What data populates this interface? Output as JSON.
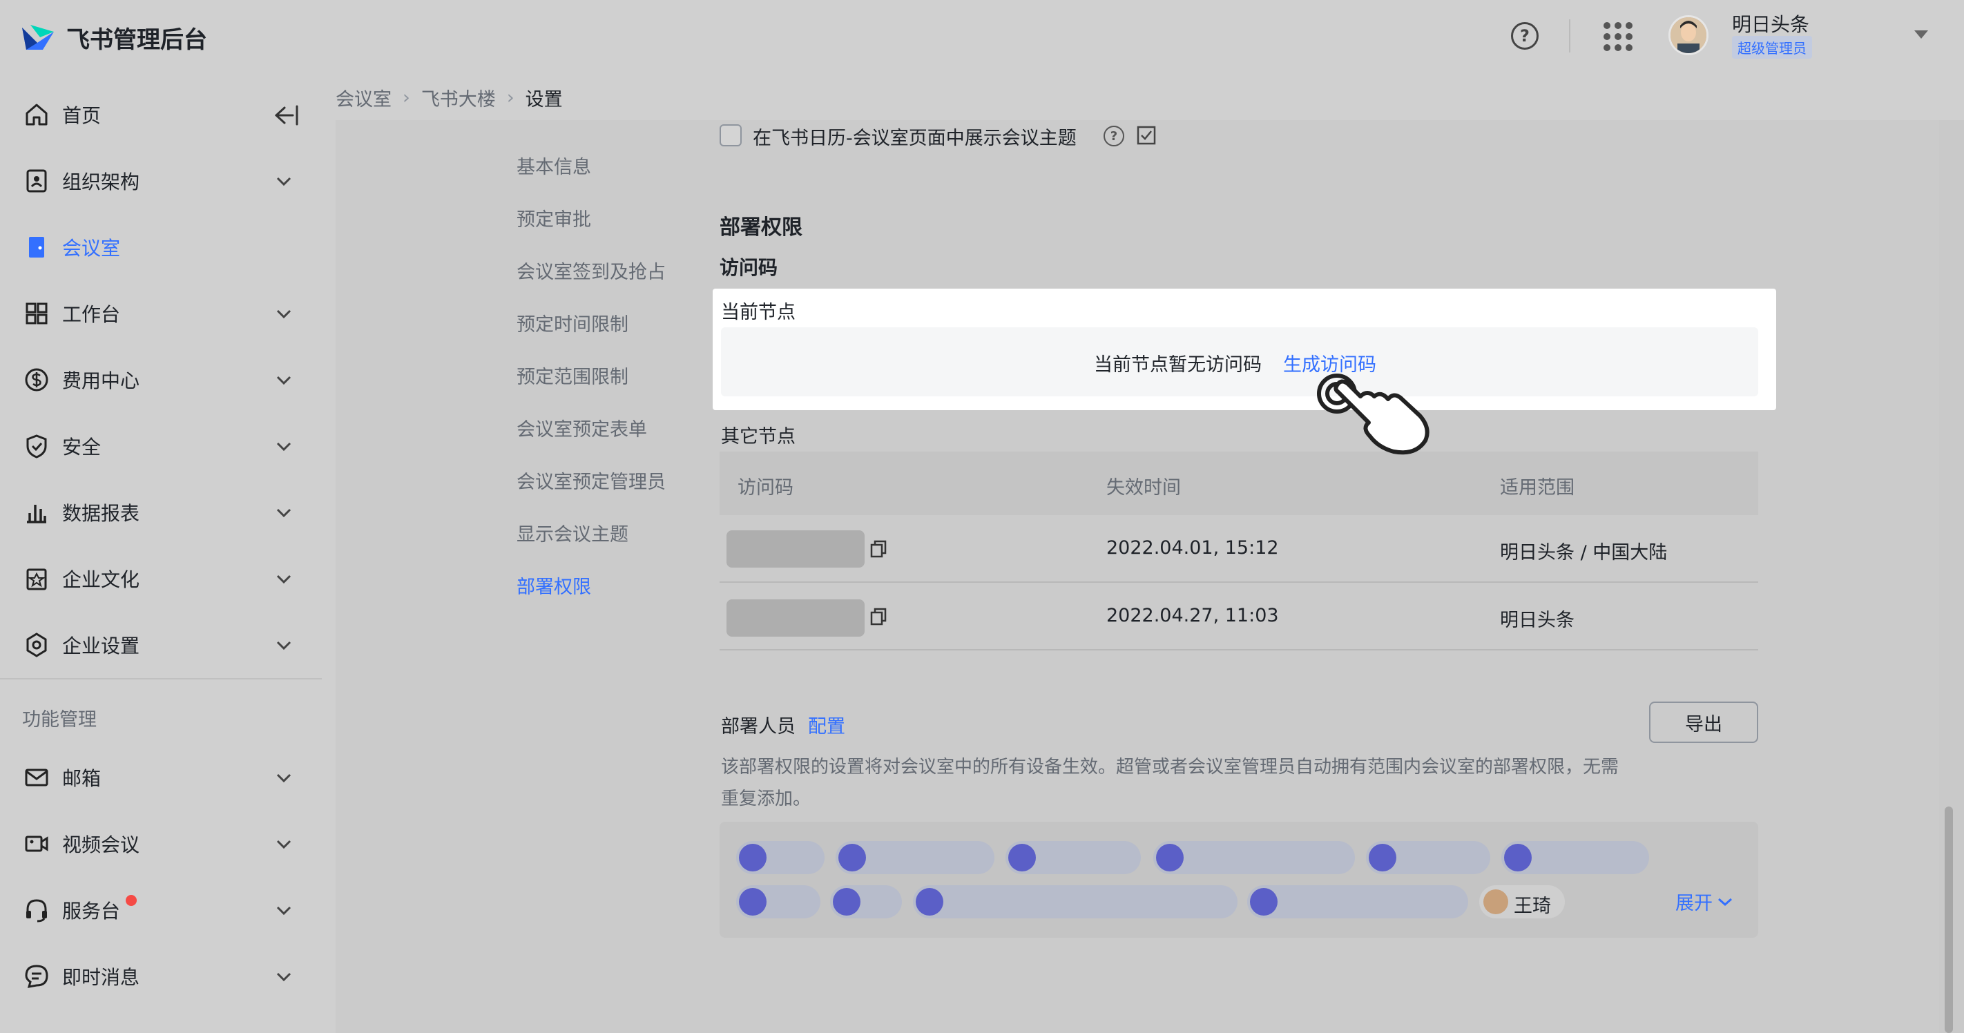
{
  "app": {
    "title": "飞书管理后台"
  },
  "header": {
    "help_icon": "question-circle-icon",
    "apps_icon": "grid-dots-icon",
    "user": {
      "name": "明日头条",
      "role": "超级管理员"
    }
  },
  "sidebar": {
    "items": [
      {
        "label": "首页",
        "icon": "home-icon"
      },
      {
        "label": "组织架构",
        "icon": "org-icon"
      },
      {
        "label": "会议室",
        "icon": "door-icon",
        "active": true
      },
      {
        "label": "工作台",
        "icon": "grid-icon"
      },
      {
        "label": "费用中心",
        "icon": "dollar-icon"
      },
      {
        "label": "安全",
        "icon": "shield-icon"
      },
      {
        "label": "数据报表",
        "icon": "bar-chart-icon"
      },
      {
        "label": "企业文化",
        "icon": "culture-icon"
      },
      {
        "label": "企业设置",
        "icon": "gear-icon"
      }
    ],
    "section_title": "功能管理",
    "feature_items": [
      {
        "label": "邮箱",
        "icon": "mail-icon"
      },
      {
        "label": "视频会议",
        "icon": "video-icon"
      },
      {
        "label": "服务台",
        "icon": "headset-icon"
      },
      {
        "label": "即时消息",
        "icon": "chat-icon"
      }
    ]
  },
  "breadcrumb": {
    "items": [
      "会议室",
      "飞书大楼",
      "设置"
    ]
  },
  "subnav": {
    "items": [
      "基本信息",
      "预定审批",
      "会议室签到及抢占",
      "预定时间限制",
      "预定范围限制",
      "会议室预定表单",
      "会议室预定管理员",
      "显示会议主题",
      "部署权限"
    ],
    "active_index": 8
  },
  "settings": {
    "show_topic_checkbox": {
      "label": "在飞书日历-会议室页面中展示会议主题",
      "checked": false
    }
  },
  "deploy": {
    "section_title": "部署权限",
    "access_code_title": "访问码",
    "current_node": {
      "title": "当前节点",
      "empty_text": "当前节点暂无访问码",
      "generate_link": "生成访问码"
    },
    "other_nodes": {
      "title": "其它节点",
      "columns": [
        "访问码",
        "失效时间",
        "适用范围"
      ],
      "rows": [
        {
          "expire": "2022.04.01, 15:12",
          "scope": "明日头条 / 中国大陆"
        },
        {
          "expire": "2022.04.27, 11:03",
          "scope": "明日头条"
        }
      ]
    },
    "personnel": {
      "title": "部署人员",
      "config_link": "配置",
      "export_button": "导出",
      "description": "该部署权限的设置将对会议室中的所有设备生效。超管或者会议室管理员自动拥有范围内会议室的部署权限，无需重复添加。",
      "user_tag": "王琦",
      "expand_link": "展开"
    }
  },
  "colors": {
    "accent": "#3370ff",
    "tag_icon": "#5b5fc7",
    "badge": "#f54a45"
  }
}
